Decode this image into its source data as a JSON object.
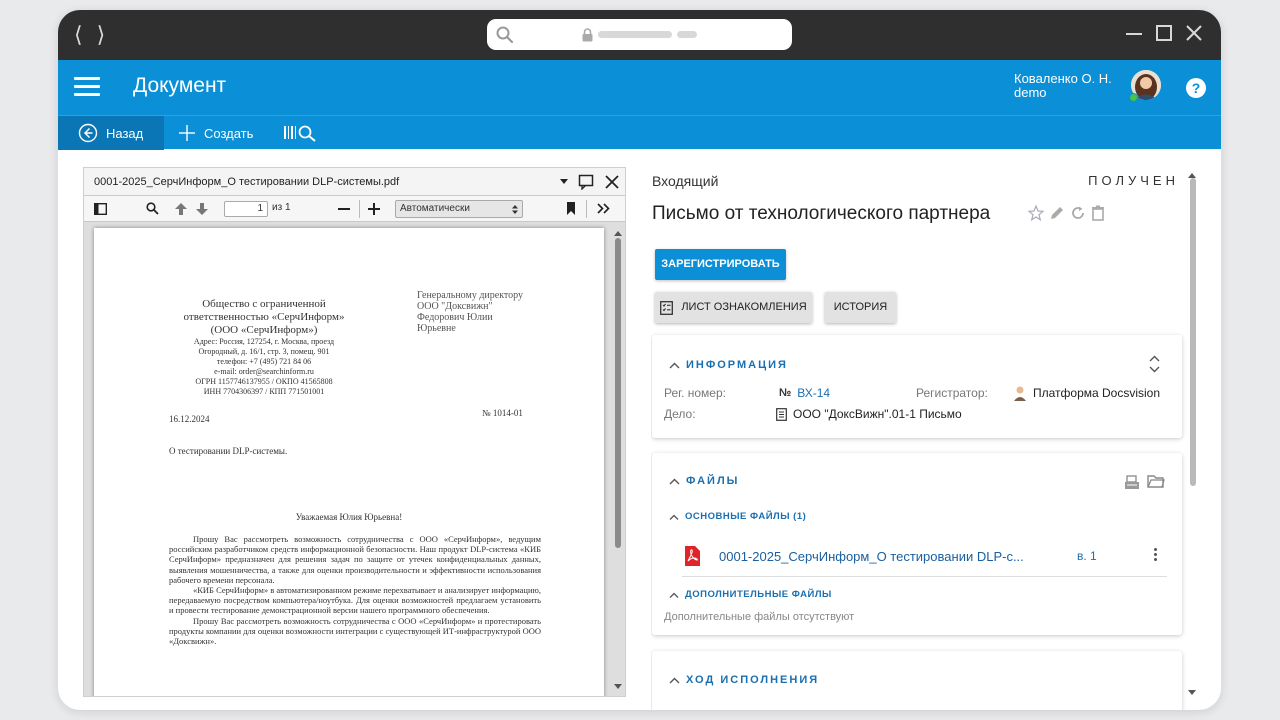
{
  "app": {
    "title": "Документ",
    "user_name": "Коваленко О. Н.",
    "user_login": "demo",
    "help_label": "?"
  },
  "toolbar": {
    "back_label": "Назад",
    "create_label": "Создать"
  },
  "pdf_viewer": {
    "filename": "0001-2025_СерчИнформ_О тестировании DLP-системы.pdf",
    "page_current": "1",
    "page_total_label": "из 1",
    "zoom": "Автоматически",
    "letter": {
      "org_line1": "Общество с ограниченной",
      "org_line2": "ответственностью «СерчИнформ»",
      "org_line3": "(ООО «СерчИнформ»)",
      "org_addr1": "Адрес: Россия, 127254, г. Москва, проезд",
      "org_addr2": "Огородный, д. 16/1, стр. 3, помещ. 901",
      "org_phone": "телефон: +7 (495) 721 84 06",
      "org_email": "e-mail: order@searchinform.ru",
      "org_ogrn": "ОГРН 1157746137955 / ОКПО 41565808",
      "org_inn": "ИНН 7704306397 / КПП 771501001",
      "to_line1": "Генеральному директору",
      "to_line2": "ООО \"Доксвижн\"",
      "to_line3": "Федорович Юлии",
      "to_line4": "Юрьевне",
      "date": "16.12.2024",
      "number": "№ 1014-01",
      "subject": "О тестировании DLP-системы.",
      "greeting": "Уважаемая Юлия Юрьевна!",
      "para1": "Прошу Вас рассмотреть возможность сотрудничества с ООО «СерчИнформ», ведущим российским разработчиком средств информационной безопасности. Наш продукт DLP-система «КИБ СерчИнформ» предназначен для решения задач по защите от утечек конфиденциальных данных, выявления мошенничества, а также для оценки производительности и эффективности использования рабочего времени персонала.",
      "para2": "«КИБ СерчИнформ» в автоматизированном режиме перехватывает и анализирует информацию, передаваемую посредством компьютера/ноутбука. Для оценки возможностей предлагаем установить и провести тестирование демонстрационной версии нашего программного обеспечения.",
      "para3": "Прошу Вас рассмотреть возможность сотрудничества с ООО «СерчИнформ» и протестировать продукты компании для оценки возможности интеграции с существующей ИТ-инфраструктурой ООО «Доксвижн»."
    }
  },
  "document": {
    "type": "Входящий",
    "state": "ПОЛУЧЕН",
    "title": "Письмо от технологического партнера",
    "register_button": "ЗАРЕГИСТРИРОВАТЬ",
    "ack_list_button": "ЛИСТ ОЗНАКОМЛЕНИЯ",
    "history_button": "ИСТОРИЯ"
  },
  "info": {
    "heading": "ИНФОРМАЦИЯ",
    "reg_number_label": "Рег. номер:",
    "reg_number_value": "ВХ-14",
    "registrar_label": "Регистратор:",
    "registrar_value": "Платформа Docsvision",
    "case_label": "Дело:",
    "case_value": "ООО \"ДоксВижн\".01-1 Письмо"
  },
  "files": {
    "heading": "ФАЙЛЫ",
    "main_heading": "ОСНОВНЫЕ ФАЙЛЫ (1)",
    "main_file_name": "0001-2025_СерчИнформ_О тестировании DLP-с...",
    "main_file_version": "в. 1",
    "extra_heading": "ДОПОЛНИТЕЛЬНЫЕ ФАЙЛЫ",
    "extra_empty": "Дополнительные файлы отсутствуют"
  },
  "execution": {
    "heading": "ХОД ИСПОЛНЕНИЯ"
  },
  "colors": {
    "primary": "#0b8fd6",
    "primary_dark": "#0a76b5",
    "link": "#1a6fb0",
    "chrome": "#2f2f2f",
    "pdf_red": "#e0242a"
  }
}
